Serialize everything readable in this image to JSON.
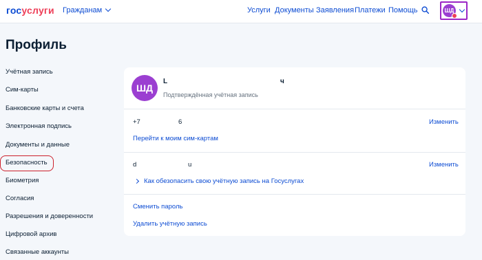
{
  "header": {
    "logo_part1": "гос",
    "logo_part2": "услуги",
    "citizens_label": "Гражданам",
    "nav": [
      "Услуги",
      "Документы",
      "Заявления",
      "Платежи",
      "Помощь"
    ],
    "avatar_initials": "ШД"
  },
  "page": {
    "title": "Профиль"
  },
  "sidebar": {
    "items": [
      "Учётная запись",
      "Сим-карты",
      "Банковские карты и счета",
      "Электронная подпись",
      "Документы и данные",
      "Безопасность",
      "Биометрия",
      "Согласия",
      "Разрешения и доверенности",
      "Цифровой архив",
      "Связанные аккаунты"
    ],
    "selected": "Безопасность"
  },
  "profile": {
    "initials": "ШД",
    "name_start": "L",
    "name_end": "ч",
    "status": "Подтверждённая учётная запись"
  },
  "phone": {
    "value_start": "+7",
    "value_end": "6",
    "change_label": "Изменить",
    "sim_link": "Перейти к моим сим-картам"
  },
  "email": {
    "value_start": "d",
    "value_end": "u",
    "change_label": "Изменить",
    "secure_link": "Как обезопасить свою учётную запись на Госуслугах"
  },
  "actions": {
    "change_password": "Сменить пароль",
    "delete_account": "Удалить учётную запись"
  },
  "colors": {
    "accent": "#0d4cd3",
    "brand_red": "#ee3f58",
    "avatar": "#9b3fd1",
    "highlight": "#cc1f2a",
    "background": "#f4f7fb"
  }
}
